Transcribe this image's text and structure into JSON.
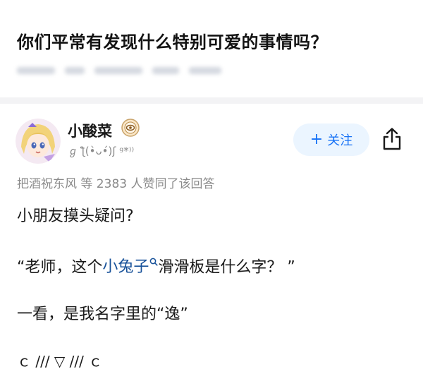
{
  "question": {
    "title": "你们平常有发现什么特别可爱的事情吗？"
  },
  "author": {
    "name": "小酸菜",
    "signature": "ℊ ƪ(•̀ᴗ•́)ʃ ᵍ*⁾⁾",
    "follow_label": "关注",
    "follow_plus": "+"
  },
  "answer": {
    "likes": "把酒祝东风 等 2383 人赞同了该回答",
    "paragraph1": "小朋友摸头疑问?",
    "paragraph2_before": "“老师，这个",
    "paragraph2_link": "小兔子",
    "paragraph2_after": "滑滑板是什么字？ ”",
    "paragraph3": "一看，是我名字里的“逸”",
    "paragraph4": "ｃ /// ▽ /// ｃ"
  },
  "colors": {
    "accent": "#1772f6",
    "follow_bg": "#ebf5ff",
    "link": "#175199",
    "meta": "#8a8a8a"
  },
  "icons": {
    "badge": "eye-badge-icon",
    "share": "share-icon",
    "search": "search-mini-icon"
  }
}
